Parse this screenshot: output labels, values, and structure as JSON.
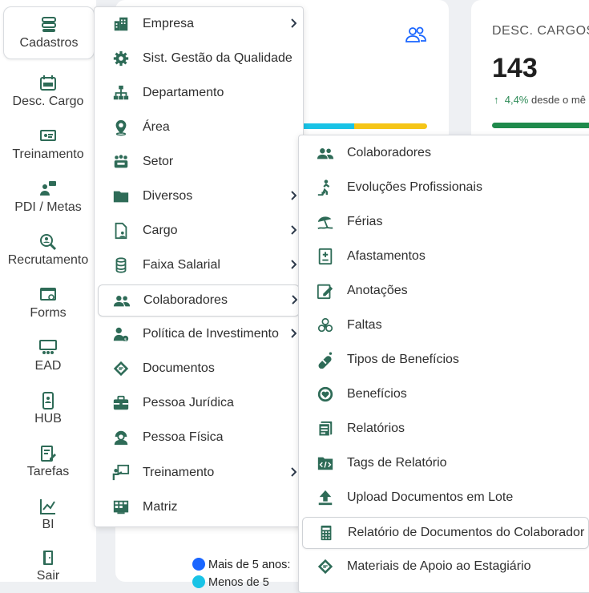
{
  "sidebar": {
    "items": [
      {
        "label": "Cadastros",
        "icon": "database-icon"
      },
      {
        "label": "Desc. Cargo",
        "icon": "calendar-icon"
      },
      {
        "label": "Treinamento",
        "icon": "presentation-icon"
      },
      {
        "label": "PDI / Metas",
        "icon": "person-chat-icon"
      },
      {
        "label": "Recrutamento",
        "icon": "search-person-icon"
      },
      {
        "label": "Forms",
        "icon": "form-icon"
      },
      {
        "label": "EAD",
        "icon": "classroom-icon"
      },
      {
        "label": "HUB",
        "icon": "phone-user-icon"
      },
      {
        "label": "Tarefas",
        "icon": "edit-task-icon"
      },
      {
        "label": "BI",
        "icon": "line-chart-icon"
      },
      {
        "label": "Sair",
        "icon": "exit-door-icon"
      }
    ]
  },
  "dashboard": {
    "card2_title": "DESC. CARGOS",
    "card2_value": "143",
    "card2_delta_arrow": "↑",
    "card2_delta": "4,4%",
    "card2_since": "desde o mê",
    "legend_item1": "Mais de 5 anos:",
    "legend_item2": "Menos de 5",
    "colors": {
      "accent": "#2e6b57",
      "blue": "#1a66ff",
      "cyan": "#19c3e6",
      "yellow": "#f5c518",
      "green": "#1f8a4c"
    }
  },
  "menu_cadastros": {
    "items": [
      {
        "label": "Empresa",
        "icon": "building-icon",
        "submenu": true
      },
      {
        "label": "Sist. Gestão da Qualidade",
        "icon": "gear-icon",
        "submenu": false
      },
      {
        "label": "Departamento",
        "icon": "org-chart-icon",
        "submenu": false
      },
      {
        "label": "Área",
        "icon": "map-pin-icon",
        "submenu": false
      },
      {
        "label": "Setor",
        "icon": "team-icon",
        "submenu": false
      },
      {
        "label": "Diversos",
        "icon": "folder-icon",
        "submenu": true
      },
      {
        "label": "Cargo",
        "icon": "document-user-icon",
        "submenu": true
      },
      {
        "label": "Faixa Salarial",
        "icon": "coins-icon",
        "submenu": true
      },
      {
        "label": "Colaboradores",
        "icon": "users-icon",
        "submenu": true
      },
      {
        "label": "Política de Investimento",
        "icon": "investor-icon",
        "submenu": true
      },
      {
        "label": "Documentos",
        "icon": "certificate-icon",
        "submenu": false
      },
      {
        "label": "Pessoa Jurídica",
        "icon": "briefcase-icon",
        "submenu": false
      },
      {
        "label": "Pessoa Física",
        "icon": "person-icon",
        "submenu": false
      },
      {
        "label": "Treinamento",
        "icon": "teacher-icon",
        "submenu": true
      },
      {
        "label": "Matriz",
        "icon": "matrix-icon",
        "submenu": false
      }
    ]
  },
  "menu_colaboradores": {
    "items": [
      {
        "label": "Colaboradores",
        "icon": "users-icon"
      },
      {
        "label": "Evoluções Profissionais",
        "icon": "stairs-climb-icon"
      },
      {
        "label": "Férias",
        "icon": "beach-umbrella-icon"
      },
      {
        "label": "Afastamentos",
        "icon": "medical-doc-icon"
      },
      {
        "label": "Anotações",
        "icon": "note-edit-icon"
      },
      {
        "label": "Faltas",
        "icon": "absence-icon"
      },
      {
        "label": "Tipos de Benefícios",
        "icon": "pill-icon"
      },
      {
        "label": "Benefícios",
        "icon": "heart-badge-icon"
      },
      {
        "label": "Relatórios",
        "icon": "report-icon"
      },
      {
        "label": "Tags de Relatório",
        "icon": "code-tag-icon"
      },
      {
        "label": "Upload Documentos em Lote",
        "icon": "upload-icon"
      },
      {
        "label": "Relatório de Documentos do Colaborador",
        "icon": "spreadsheet-icon"
      },
      {
        "label": "Materiais de Apoio ao Estagiário",
        "icon": "certificate-icon"
      }
    ]
  }
}
